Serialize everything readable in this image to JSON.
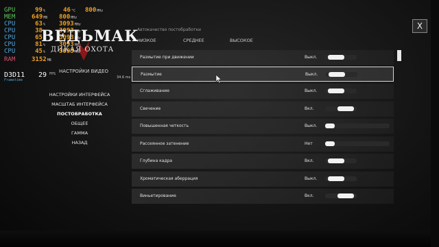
{
  "osd": {
    "rows": [
      {
        "label": "GPU",
        "v1": "99",
        "u1": "%",
        "v2": "46",
        "u2": "°C",
        "v3": "800",
        "u3": "MHz",
        "style": "green"
      },
      {
        "label": "MEM",
        "v1": "649",
        "u1": "MB",
        "v2": "800",
        "u2": "MHz",
        "v3": "",
        "u3": "",
        "style": "green"
      },
      {
        "label": "CPU",
        "v1": "63",
        "u1": "%",
        "v2": "3093",
        "u2": "MHz",
        "v3": "",
        "u3": "",
        "style": "blue"
      },
      {
        "label": "CPU",
        "v1": "38",
        "u1": "%",
        "v2": "3093",
        "u2": "MHz",
        "v3": "",
        "u3": "",
        "style": "blue"
      },
      {
        "label": "CPU",
        "v1": "65",
        "u1": "%",
        "v2": "3093",
        "u2": "MHz",
        "v3": "",
        "u3": "",
        "style": "blue"
      },
      {
        "label": "CPU",
        "v1": "81",
        "u1": "%",
        "v2": "3093",
        "u2": "MHz",
        "v3": "",
        "u3": "",
        "style": "blue"
      },
      {
        "label": "CPU",
        "v1": "45",
        "u1": "%",
        "v2": "3093",
        "u2": "MHz",
        "v3": "",
        "u3": "",
        "style": "blue"
      },
      {
        "label": "RAM",
        "v1": "3152",
        "u1": "MB",
        "v2": "",
        "u2": "",
        "v3": "",
        "u3": "",
        "style": "ram"
      }
    ],
    "api": "D3D11",
    "fps": "29",
    "fps_unit": "FPS",
    "frametime": "34.6 ms",
    "sub": "Frametime"
  },
  "logo": {
    "title": "ВЕДЬМАК",
    "subtitle": "ДИКАЯ ОХОТА"
  },
  "menu": {
    "title": "НАСТРОЙКИ ВИДЕО",
    "items": [
      "НАСТРОЙКИ ИНТЕРФЕЙСА",
      "МАСШТАБ ИНТЕРФЕЙСА",
      "ПОСТОБРАБОТКА",
      "ОБЩЕЕ",
      "ГАММА",
      "НАЗАД"
    ],
    "active": "ПОСТОБРАБОТКА"
  },
  "panel": {
    "section": "Автокачество постобработки",
    "presets": [
      "НИЗКОЕ",
      "СРЕДНЕЕ",
      "ВЫСОКОЕ"
    ],
    "rows": [
      {
        "label": "Размытие при движении",
        "value": "Выкл.",
        "kind": "toggle",
        "state": 0.0
      },
      {
        "label": "Размытие",
        "value": "Выкл.",
        "kind": "toggle",
        "state": 0.0
      },
      {
        "label": "Сглаживание",
        "value": "Выкл.",
        "kind": "toggle",
        "state": 0.0
      },
      {
        "label": "Свечение",
        "value": "Вкл.",
        "kind": "toggle",
        "state": 1.0
      },
      {
        "label": "Повышенная четкость",
        "value": "Выкл.",
        "kind": "slider",
        "state": 0.0
      },
      {
        "label": "Рассеянное затенение",
        "value": "Нет",
        "kind": "slider",
        "state": 0.0
      },
      {
        "label": "Глубина кадра",
        "value": "Вкл.",
        "kind": "toggle",
        "state": 0.0
      },
      {
        "label": "Хроматическая аберрация",
        "value": "Выкл.",
        "kind": "toggle",
        "state": 0.0
      },
      {
        "label": "Виньетирование",
        "value": "Вкл.",
        "kind": "toggle",
        "state": 1.0
      }
    ]
  },
  "close_label": "X",
  "colors": {
    "osd_orange": "#f0a020",
    "osd_blue": "#4fa6e0",
    "osd_green": "#5cc85c",
    "osd_ram": "#d85070",
    "emblem_red": "#a01818"
  }
}
